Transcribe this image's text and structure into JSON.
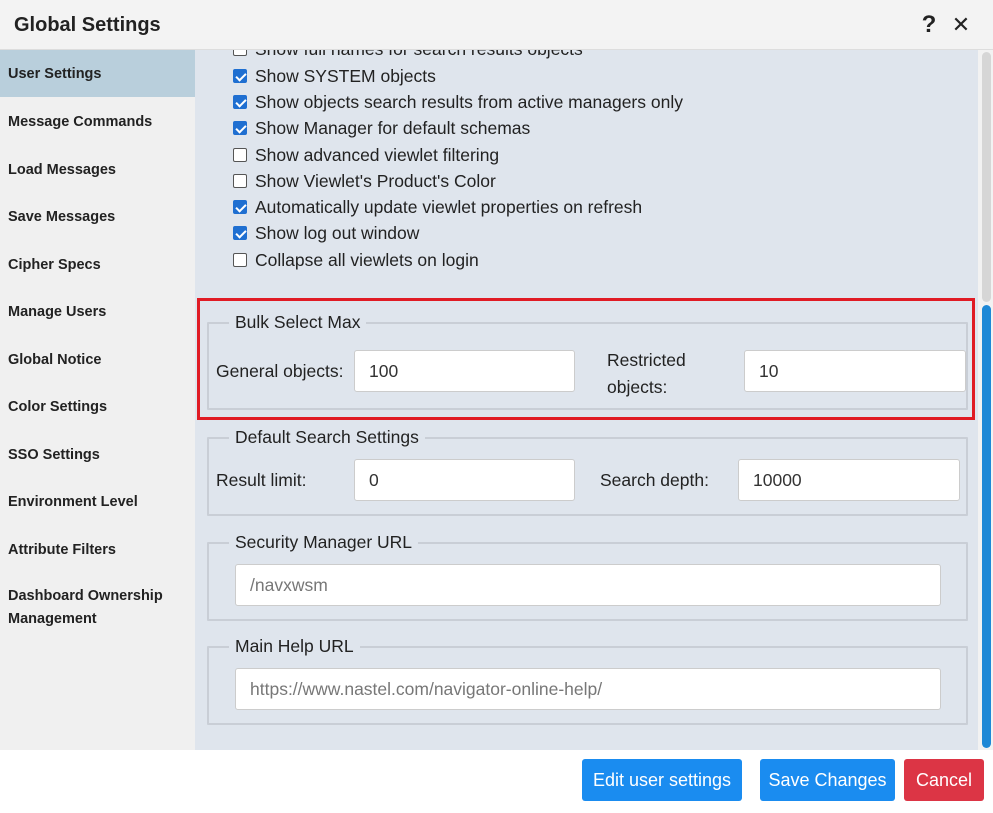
{
  "window": {
    "title": "Global Settings",
    "help_icon": "question-mark-icon",
    "close_icon": "close-x-icon"
  },
  "sidebar": {
    "items": [
      {
        "label": "User Settings",
        "active": true
      },
      {
        "label": "Message Commands"
      },
      {
        "label": "Load Messages"
      },
      {
        "label": "Save Messages"
      },
      {
        "label": "Cipher Specs"
      },
      {
        "label": "Manage Users"
      },
      {
        "label": "Global Notice"
      },
      {
        "label": "Color Settings"
      },
      {
        "label": "SSO Settings"
      },
      {
        "label": "Environment Level"
      },
      {
        "label": "Attribute Filters"
      },
      {
        "label_line1": "Dashboard Ownership",
        "label_line2": "Management"
      }
    ]
  },
  "checkboxes": [
    {
      "label": "Show full names for search results objects",
      "checked": false
    },
    {
      "label": "Show SYSTEM objects",
      "checked": true
    },
    {
      "label": "Show objects search results from active managers only",
      "checked": true
    },
    {
      "label": "Show Manager for default schemas",
      "checked": true
    },
    {
      "label": "Show advanced viewlet filtering",
      "checked": false
    },
    {
      "label": "Show Viewlet's Product's Color",
      "checked": false
    },
    {
      "label": "Automatically update viewlet properties on refresh",
      "checked": true
    },
    {
      "label": "Show log out window",
      "checked": true
    },
    {
      "label": "Collapse all viewlets on login",
      "checked": false
    }
  ],
  "bulk_select": {
    "legend": "Bulk Select Max",
    "general_label": "General objects:",
    "general_value": "100",
    "restricted_label_line1": "Restricted",
    "restricted_label_line2": "objects:",
    "restricted_value": "10"
  },
  "default_search": {
    "legend": "Default Search Settings",
    "result_limit_label": "Result limit:",
    "result_limit_value": "0",
    "search_depth_label": "Search depth:",
    "search_depth_value": "10000"
  },
  "security_manager": {
    "legend": "Security Manager URL",
    "placeholder": "/navxwsm"
  },
  "main_help": {
    "legend": "Main Help URL",
    "placeholder": "https://www.nastel.com/navigator-online-help/"
  },
  "footer": {
    "edit_label": "Edit user settings",
    "save_label": "Save Changes",
    "cancel_label": "Cancel"
  },
  "colors": {
    "accent_blue": "#1a8cf0",
    "cancel_red": "#dc3545",
    "highlight_red": "#e01b24",
    "active_sidebar": "#b9cfdc"
  }
}
